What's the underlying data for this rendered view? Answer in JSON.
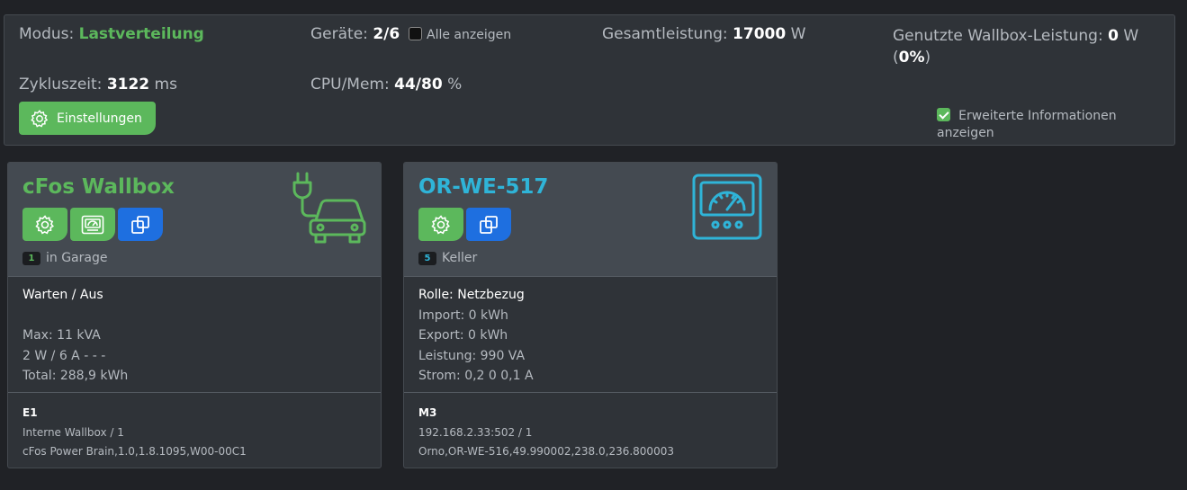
{
  "header": {
    "modus_label": "Modus:",
    "modus_value": "Lastverteilung",
    "geraete_label": "Geräte:",
    "geraete_value": "2/6",
    "alle_anzeigen_label": "Alle anzeigen",
    "gesamtleistung_label": "Gesamtleistung:",
    "gesamtleistung_value": "17000",
    "gesamtleistung_unit": "W",
    "wallbox_label": "Genutzte Wallbox-Leistung:",
    "wallbox_value": "0",
    "wallbox_unit": "W",
    "wallbox_pct_open": "(",
    "wallbox_pct": "0%",
    "wallbox_pct_close": ")",
    "zyklus_label": "Zykluszeit:",
    "zyklus_value": "3122",
    "zyklus_unit": "ms",
    "cpu_label": "CPU/Mem:",
    "cpu_value": "44/80",
    "cpu_unit": "%",
    "settings_button": "Einstellungen",
    "erweiterte_label": "Erweiterte Informationen anzeigen",
    "alle_anzeigen_checked": false,
    "erweiterte_checked": true
  },
  "colors": {
    "green": "#5cb85c",
    "blue": "#1e6fe0",
    "cyan": "#2fb4d8"
  },
  "cards": [
    {
      "title": "cFos Wallbox",
      "title_color": "#5cb85c",
      "icon": "car-charger-icon",
      "badge": "1",
      "badge_color": "#5cb85c",
      "location": "in Garage",
      "status": "Warten / Aus",
      "lines": [
        "",
        "Max: 11 kVA",
        "2 W / 6 A - - -",
        "Total: 288,9 kWh"
      ],
      "device_id": "E1",
      "address": "Interne Wallbox / 1",
      "info": "cFos Power Brain,1.0,1.8.1095,W00-00C1"
    },
    {
      "title": "OR-WE-517",
      "title_color": "#2fb4d8",
      "icon": "meter-gauge-icon",
      "badge": "5",
      "badge_color": "#2fb4d8",
      "location": "Keller",
      "status": "Rolle: Netzbezug",
      "lines": [
        "Import: 0 kWh",
        "Export: 0 kWh",
        "Leistung: 990 VA",
        "Strom: 0,2 0 0,1 A"
      ],
      "device_id": "M3",
      "address": "192.168.2.33:502 / 1",
      "info": "Orno,OR-WE-516,49.990002,238.0,236.800003"
    }
  ]
}
